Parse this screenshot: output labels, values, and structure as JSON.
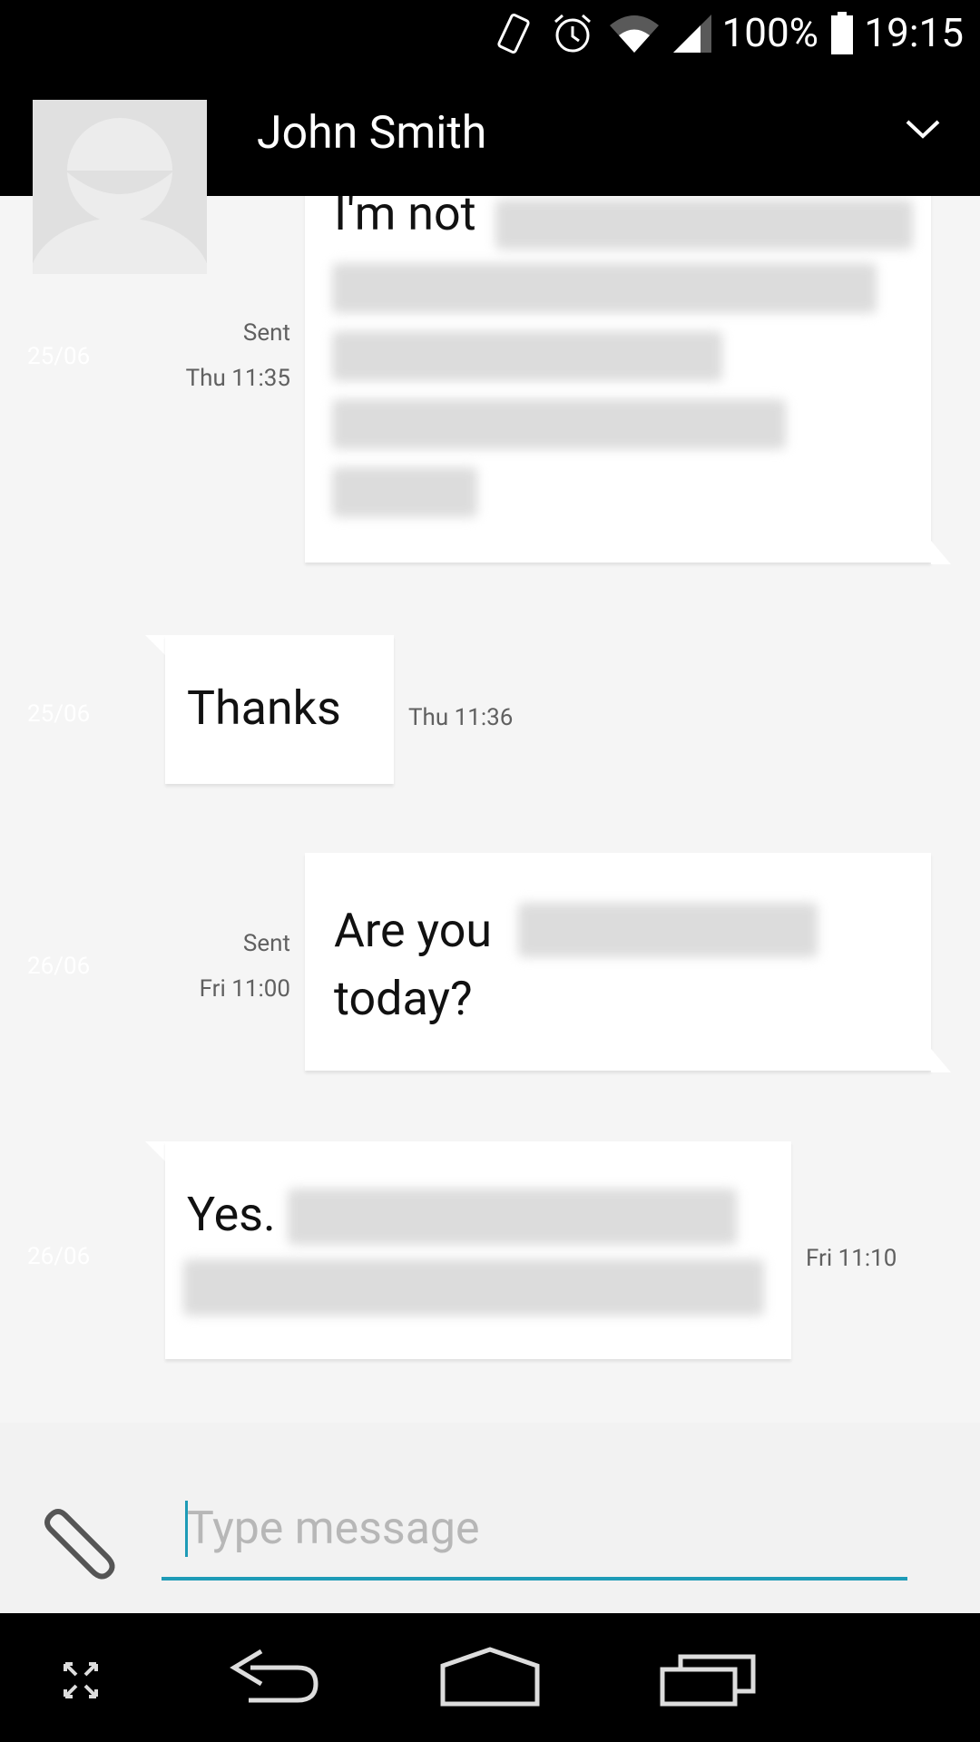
{
  "status_bar": {
    "battery": "100%",
    "time": "19:15"
  },
  "header": {
    "contact_name": "John Smith"
  },
  "messages": [
    {
      "date": "25/06",
      "direction": "sent",
      "status": "Sent",
      "time": "Thu 11:35",
      "visible_text": "I'm not"
    },
    {
      "date": "25/06",
      "direction": "received",
      "time": "Thu 11:36",
      "visible_text": "Thanks"
    },
    {
      "date": "26/06",
      "direction": "sent",
      "status": "Sent",
      "time": "Fri 11:00",
      "visible_text_1": "Are you",
      "visible_text_2": "today?"
    },
    {
      "date": "26/06",
      "direction": "received",
      "time": "Fri 11:10",
      "visible_text": "Yes."
    }
  ],
  "composer": {
    "placeholder": "Type message"
  },
  "colors": {
    "accent": "#1e9bb7",
    "background": "#f5f5f5",
    "bars": "#000000"
  }
}
